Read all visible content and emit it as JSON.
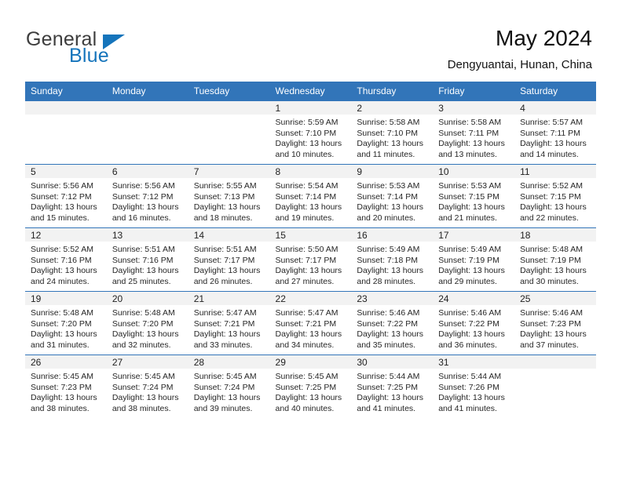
{
  "brand": {
    "name_part1": "General",
    "name_part2": "Blue",
    "logo_icon": "triangle-flag-icon",
    "accent_color": "#1574bb"
  },
  "header": {
    "month_title": "May 2024",
    "location": "Dengyuantai, Hunan, China"
  },
  "theme": {
    "header_blue": "#3275b9",
    "daynum_band": "#f2f2f2",
    "text": "#262626"
  },
  "calendar": {
    "weekday_headers": [
      "Sunday",
      "Monday",
      "Tuesday",
      "Wednesday",
      "Thursday",
      "Friday",
      "Saturday"
    ],
    "labels": {
      "sunrise": "Sunrise:",
      "sunset": "Sunset:",
      "daylight": "Daylight:"
    },
    "weeks": [
      [
        {
          "day": "",
          "blank": true
        },
        {
          "day": "",
          "blank": true
        },
        {
          "day": "",
          "blank": true
        },
        {
          "day": "1",
          "sunrise": "Sunrise: 5:59 AM",
          "sunset": "Sunset: 7:10 PM",
          "daylight": "Daylight: 13 hours and 10 minutes."
        },
        {
          "day": "2",
          "sunrise": "Sunrise: 5:58 AM",
          "sunset": "Sunset: 7:10 PM",
          "daylight": "Daylight: 13 hours and 11 minutes."
        },
        {
          "day": "3",
          "sunrise": "Sunrise: 5:58 AM",
          "sunset": "Sunset: 7:11 PM",
          "daylight": "Daylight: 13 hours and 13 minutes."
        },
        {
          "day": "4",
          "sunrise": "Sunrise: 5:57 AM",
          "sunset": "Sunset: 7:11 PM",
          "daylight": "Daylight: 13 hours and 14 minutes."
        }
      ],
      [
        {
          "day": "5",
          "sunrise": "Sunrise: 5:56 AM",
          "sunset": "Sunset: 7:12 PM",
          "daylight": "Daylight: 13 hours and 15 minutes."
        },
        {
          "day": "6",
          "sunrise": "Sunrise: 5:56 AM",
          "sunset": "Sunset: 7:12 PM",
          "daylight": "Daylight: 13 hours and 16 minutes."
        },
        {
          "day": "7",
          "sunrise": "Sunrise: 5:55 AM",
          "sunset": "Sunset: 7:13 PM",
          "daylight": "Daylight: 13 hours and 18 minutes."
        },
        {
          "day": "8",
          "sunrise": "Sunrise: 5:54 AM",
          "sunset": "Sunset: 7:14 PM",
          "daylight": "Daylight: 13 hours and 19 minutes."
        },
        {
          "day": "9",
          "sunrise": "Sunrise: 5:53 AM",
          "sunset": "Sunset: 7:14 PM",
          "daylight": "Daylight: 13 hours and 20 minutes."
        },
        {
          "day": "10",
          "sunrise": "Sunrise: 5:53 AM",
          "sunset": "Sunset: 7:15 PM",
          "daylight": "Daylight: 13 hours and 21 minutes."
        },
        {
          "day": "11",
          "sunrise": "Sunrise: 5:52 AM",
          "sunset": "Sunset: 7:15 PM",
          "daylight": "Daylight: 13 hours and 22 minutes."
        }
      ],
      [
        {
          "day": "12",
          "sunrise": "Sunrise: 5:52 AM",
          "sunset": "Sunset: 7:16 PM",
          "daylight": "Daylight: 13 hours and 24 minutes."
        },
        {
          "day": "13",
          "sunrise": "Sunrise: 5:51 AM",
          "sunset": "Sunset: 7:16 PM",
          "daylight": "Daylight: 13 hours and 25 minutes."
        },
        {
          "day": "14",
          "sunrise": "Sunrise: 5:51 AM",
          "sunset": "Sunset: 7:17 PM",
          "daylight": "Daylight: 13 hours and 26 minutes."
        },
        {
          "day": "15",
          "sunrise": "Sunrise: 5:50 AM",
          "sunset": "Sunset: 7:17 PM",
          "daylight": "Daylight: 13 hours and 27 minutes."
        },
        {
          "day": "16",
          "sunrise": "Sunrise: 5:49 AM",
          "sunset": "Sunset: 7:18 PM",
          "daylight": "Daylight: 13 hours and 28 minutes."
        },
        {
          "day": "17",
          "sunrise": "Sunrise: 5:49 AM",
          "sunset": "Sunset: 7:19 PM",
          "daylight": "Daylight: 13 hours and 29 minutes."
        },
        {
          "day": "18",
          "sunrise": "Sunrise: 5:48 AM",
          "sunset": "Sunset: 7:19 PM",
          "daylight": "Daylight: 13 hours and 30 minutes."
        }
      ],
      [
        {
          "day": "19",
          "sunrise": "Sunrise: 5:48 AM",
          "sunset": "Sunset: 7:20 PM",
          "daylight": "Daylight: 13 hours and 31 minutes."
        },
        {
          "day": "20",
          "sunrise": "Sunrise: 5:48 AM",
          "sunset": "Sunset: 7:20 PM",
          "daylight": "Daylight: 13 hours and 32 minutes."
        },
        {
          "day": "21",
          "sunrise": "Sunrise: 5:47 AM",
          "sunset": "Sunset: 7:21 PM",
          "daylight": "Daylight: 13 hours and 33 minutes."
        },
        {
          "day": "22",
          "sunrise": "Sunrise: 5:47 AM",
          "sunset": "Sunset: 7:21 PM",
          "daylight": "Daylight: 13 hours and 34 minutes."
        },
        {
          "day": "23",
          "sunrise": "Sunrise: 5:46 AM",
          "sunset": "Sunset: 7:22 PM",
          "daylight": "Daylight: 13 hours and 35 minutes."
        },
        {
          "day": "24",
          "sunrise": "Sunrise: 5:46 AM",
          "sunset": "Sunset: 7:22 PM",
          "daylight": "Daylight: 13 hours and 36 minutes."
        },
        {
          "day": "25",
          "sunrise": "Sunrise: 5:46 AM",
          "sunset": "Sunset: 7:23 PM",
          "daylight": "Daylight: 13 hours and 37 minutes."
        }
      ],
      [
        {
          "day": "26",
          "sunrise": "Sunrise: 5:45 AM",
          "sunset": "Sunset: 7:23 PM",
          "daylight": "Daylight: 13 hours and 38 minutes."
        },
        {
          "day": "27",
          "sunrise": "Sunrise: 5:45 AM",
          "sunset": "Sunset: 7:24 PM",
          "daylight": "Daylight: 13 hours and 38 minutes."
        },
        {
          "day": "28",
          "sunrise": "Sunrise: 5:45 AM",
          "sunset": "Sunset: 7:24 PM",
          "daylight": "Daylight: 13 hours and 39 minutes."
        },
        {
          "day": "29",
          "sunrise": "Sunrise: 5:45 AM",
          "sunset": "Sunset: 7:25 PM",
          "daylight": "Daylight: 13 hours and 40 minutes."
        },
        {
          "day": "30",
          "sunrise": "Sunrise: 5:44 AM",
          "sunset": "Sunset: 7:25 PM",
          "daylight": "Daylight: 13 hours and 41 minutes."
        },
        {
          "day": "31",
          "sunrise": "Sunrise: 5:44 AM",
          "sunset": "Sunset: 7:26 PM",
          "daylight": "Daylight: 13 hours and 41 minutes."
        },
        {
          "day": "",
          "blank": true
        }
      ]
    ]
  }
}
